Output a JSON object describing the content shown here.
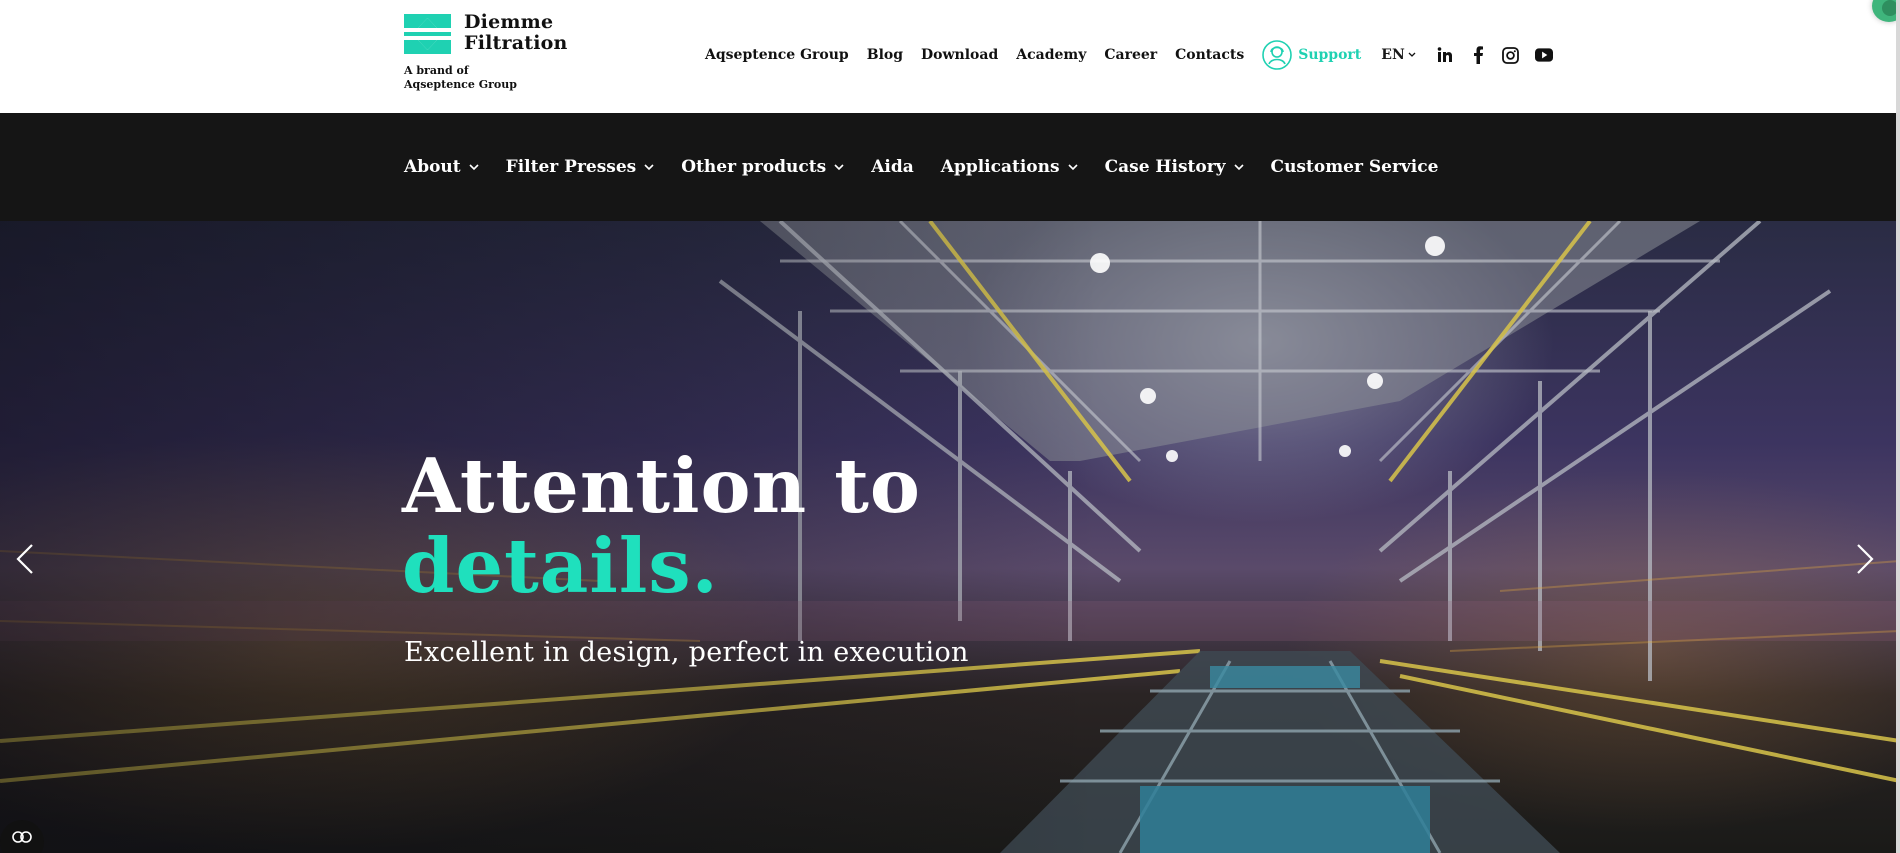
{
  "brand": {
    "name_line1": "Diemme",
    "name_line2": "Filtration",
    "tagline_line1": "A brand of",
    "tagline_line2": "Aqseptence Group",
    "accent_color": "#1fd1b2"
  },
  "utility_nav": {
    "links": [
      "Aqseptence Group",
      "Blog",
      "Download",
      "Academy",
      "Career",
      "Contacts"
    ],
    "support_label": "Support",
    "support_icon": "support-agent-icon",
    "language": "EN",
    "social_icons": [
      "linkedin-icon",
      "facebook-icon",
      "instagram-icon",
      "youtube-icon"
    ]
  },
  "main_nav": {
    "items": [
      {
        "label": "About",
        "has_dropdown": true
      },
      {
        "label": "Filter Presses",
        "has_dropdown": true
      },
      {
        "label": "Other products",
        "has_dropdown": true
      },
      {
        "label": "Aida",
        "has_dropdown": false
      },
      {
        "label": "Applications",
        "has_dropdown": true
      },
      {
        "label": "Case History",
        "has_dropdown": true
      },
      {
        "label": "Customer Service",
        "has_dropdown": false
      }
    ]
  },
  "hero": {
    "title_line1": "Attention to",
    "title_line2": "details.",
    "subtitle": "Excellent in design, perfect in execution",
    "prev_icon": "chevron-left-icon",
    "next_icon": "chevron-right-icon"
  },
  "cookie_button": {
    "icon": "cookie-settings-icon"
  }
}
